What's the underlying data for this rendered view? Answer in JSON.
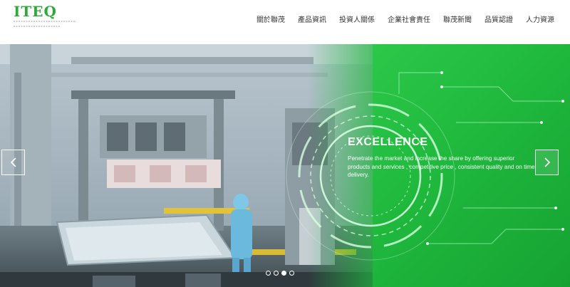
{
  "header": {
    "logo_text": "ITEQ",
    "logo_tagline": "INNOVATION · TECHNOLOGY EXCELLENCE · QUALITY",
    "nav": [
      {
        "label": "關於聯茂"
      },
      {
        "label": "產品資訊"
      },
      {
        "label": "投資人關係"
      },
      {
        "label": "企業社會責任"
      },
      {
        "label": "聯茂新聞"
      },
      {
        "label": "品質認證"
      },
      {
        "label": "人力資源"
      }
    ]
  },
  "hero": {
    "title": "EXCELLENCE",
    "body": "Penetrate the market and increase the share by offering superior products and services , competitive price , consistent quality and on time delivery.",
    "prev_icon": "chevron-left-icon",
    "next_icon": "chevron-right-icon",
    "slide_count": 4,
    "active_slide": 3
  },
  "colors": {
    "brand_green": "#2fa838",
    "panel_green": "#1fb83d",
    "nav_text": "#333333"
  }
}
